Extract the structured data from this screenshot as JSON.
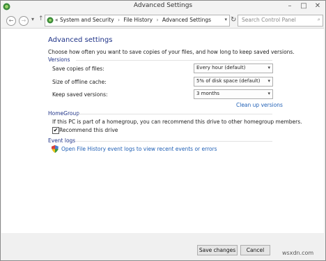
{
  "window": {
    "title": "Advanced Settings",
    "controls": {
      "minimize": "–",
      "maximize": "□",
      "close": "✕"
    }
  },
  "address_bar": {
    "back_icon": "←",
    "forward_icon": "→",
    "recent_icon": "▾",
    "up_icon": "↑",
    "prefix": "«",
    "breadcrumbs": [
      "System and Security",
      "File History",
      "Advanced Settings"
    ],
    "separator": "›",
    "dropdown_icon": "▾",
    "refresh_icon": "↻",
    "search_placeholder": "Search Control Panel",
    "search_icon": "⌕"
  },
  "main": {
    "heading": "Advanced settings",
    "intro": "Choose how often you want to save copies of your files, and how long to keep saved versions.",
    "versions": {
      "title": "Versions",
      "rows": [
        {
          "label": "Save copies of files:",
          "value": "Every hour (default)"
        },
        {
          "label": "Size of offline cache:",
          "value": "5% of disk space (default)"
        },
        {
          "label": "Keep saved versions:",
          "value": "3 months"
        }
      ],
      "select_arrow": "▾",
      "cleanup_link": "Clean up versions"
    },
    "homegroup": {
      "title": "HomeGroup",
      "text": "If this PC is part of a homegroup, you can recommend this drive to other homegroup members.",
      "checkbox_label": "Recommend this drive",
      "checked_mark": "✔"
    },
    "event_logs": {
      "title": "Event logs",
      "link": "Open File History event logs to view recent events or errors"
    }
  },
  "footer": {
    "save_label": "Save changes",
    "cancel_label": "Cancel"
  },
  "watermark": "wsxdn.com"
}
